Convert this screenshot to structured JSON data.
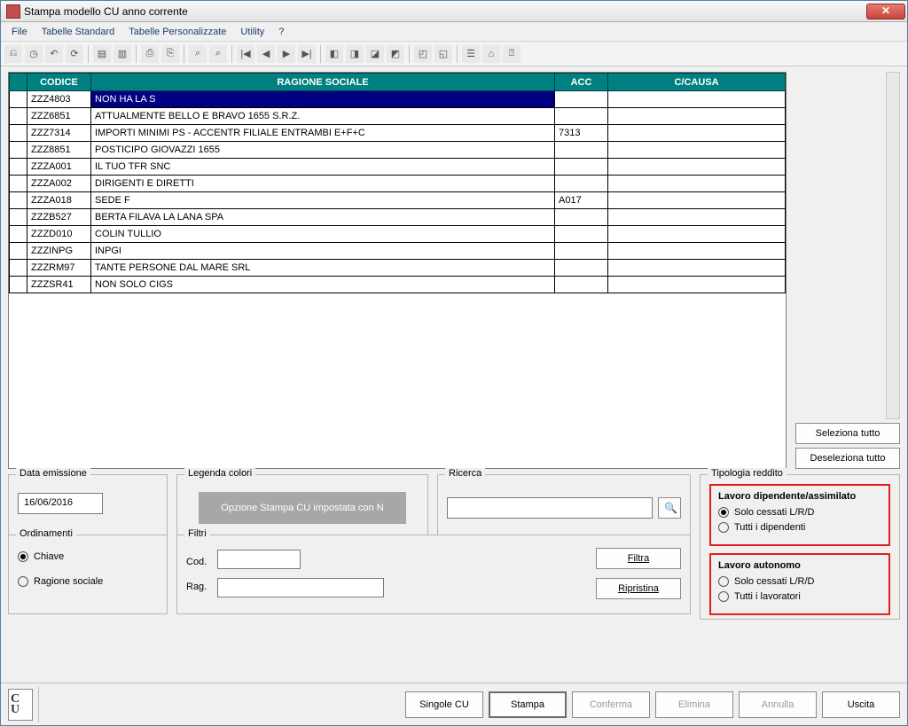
{
  "title": "Stampa modello CU anno corrente",
  "close_glyph": "✕",
  "menu": {
    "file": "File",
    "tabstd": "Tabelle Standard",
    "tabpers": "Tabelle Personalizzate",
    "utility": "Utility",
    "help": "?"
  },
  "grid": {
    "headers": {
      "codice": "CODICE",
      "ragione": "RAGIONE SOCIALE",
      "acc": "ACC",
      "causa": "C/CAUSA"
    },
    "rows": [
      {
        "codice": "ZZZ4803",
        "ragione": "NON HA LA S",
        "acc": "",
        "causa": "",
        "selected": true
      },
      {
        "codice": "ZZZ6851",
        "ragione": "ATTUALMENTE BELLO E BRAVO 1655 S.R.Z.",
        "acc": "",
        "causa": ""
      },
      {
        "codice": "ZZZ7314",
        "ragione": "IMPORTI MINIMI PS - ACCENTR FILIALE ENTRAMBI E+F+C",
        "acc": "7313",
        "causa": ""
      },
      {
        "codice": "ZZZ8851",
        "ragione": "POSTICIPO GIOVAZZI 1655",
        "acc": "",
        "causa": ""
      },
      {
        "codice": "ZZZA001",
        "ragione": "IL TUO TFR SNC",
        "acc": "",
        "causa": ""
      },
      {
        "codice": "ZZZA002",
        "ragione": "DIRIGENTI E DIRETTI",
        "acc": "",
        "causa": ""
      },
      {
        "codice": "ZZZA018",
        "ragione": "SEDE F",
        "acc": "A017",
        "causa": ""
      },
      {
        "codice": "ZZZB527",
        "ragione": "BERTA FILAVA LA LANA SPA",
        "acc": "",
        "causa": ""
      },
      {
        "codice": "ZZZD010",
        "ragione": "COLIN TULLIO",
        "acc": "",
        "causa": ""
      },
      {
        "codice": "ZZZINPG",
        "ragione": "INPGI",
        "acc": "",
        "causa": ""
      },
      {
        "codice": "ZZZRM97",
        "ragione": "TANTE PERSONE DAL MARE SRL",
        "acc": "",
        "causa": ""
      },
      {
        "codice": "ZZZSR41",
        "ragione": "NON SOLO CIGS",
        "acc": "",
        "causa": ""
      }
    ]
  },
  "side_buttons": {
    "select_all": "Seleziona tutto",
    "deselect_all": "Deseleziona tutto"
  },
  "data_emissione": {
    "legend": "Data emissione",
    "value": "16/06/2016"
  },
  "legenda_colori": {
    "legend": "Legenda colori",
    "button": "Opzione Stampa CU impostata con N"
  },
  "ricerca": {
    "legend": "Ricerca",
    "value": "",
    "icon": "🔍"
  },
  "tipologia": {
    "legend": "Tipologia reddito",
    "dipendente": {
      "title": "Lavoro dipendente/assimilato",
      "opt1": "Solo cessati L/R/D",
      "opt2": "Tutti i dipendenti",
      "selected": "opt1"
    },
    "autonomo": {
      "title": "Lavoro autonomo",
      "opt1": "Solo cessati L/R/D",
      "opt2": "Tutti i lavoratori",
      "selected": ""
    }
  },
  "ordinamenti": {
    "legend": "Ordinamenti",
    "opt1": "Chiave",
    "opt2": "Ragione sociale",
    "selected": "opt1"
  },
  "filtri": {
    "legend": "Filtri",
    "cod_label": "Cod.",
    "rag_label": "Rag.",
    "cod": "",
    "rag": "",
    "filtra": "Filtra",
    "ripristina": "Ripristina"
  },
  "bottom": {
    "singole": "Singole CU",
    "stampa": "Stampa",
    "conferma": "Conferma",
    "elimina": "Elimina",
    "annulla": "Annulla",
    "uscita": "Uscita"
  },
  "toolbar_icons": [
    "⎌",
    "◷",
    "↶",
    "⟳",
    "",
    "▤",
    "▥",
    "",
    "⎙",
    "⎘",
    "",
    "⌕",
    "⌕",
    "",
    "|◀",
    "◀",
    "▶",
    "▶|",
    "",
    "◧",
    "◨",
    "◪",
    "◩",
    "",
    "◰",
    "◱",
    "",
    "☰",
    "⌂",
    "⍰"
  ]
}
